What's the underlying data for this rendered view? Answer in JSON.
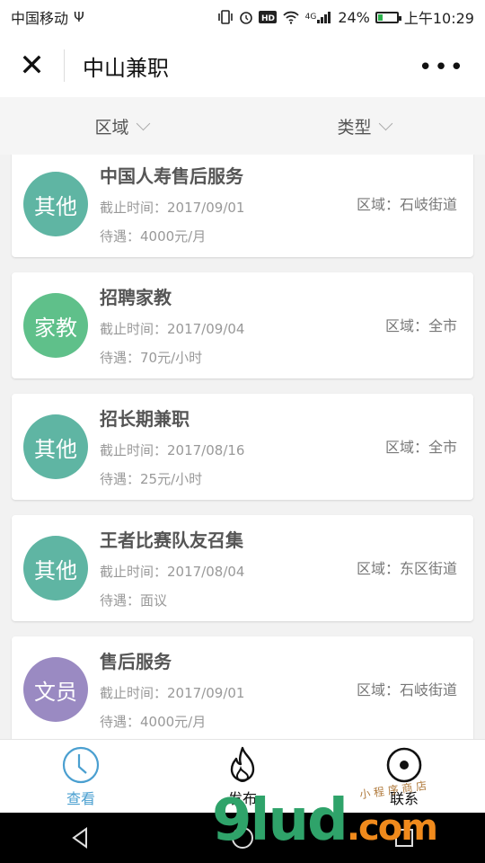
{
  "status_bar": {
    "carrier": "中国移动",
    "usb_glyph": "Ψ",
    "network": "4G",
    "battery": "24%",
    "battery_level": 0.24,
    "time": "上午10:29"
  },
  "navbar": {
    "close_glyph": "✕",
    "title": "中山兼职",
    "more_glyph": "•••"
  },
  "filters": [
    {
      "label": "区域"
    },
    {
      "label": "类型"
    }
  ],
  "jobs": [
    {
      "avatar_text": "其他",
      "avatar_color": "#5fb5a3",
      "title": "中国人寿售后服务",
      "deadline": "截止时间：2017/09/01",
      "pay": "待遇：4000元/月",
      "area": "区域：石岐街道"
    },
    {
      "avatar_text": "家教",
      "avatar_color": "#5fc08a",
      "title": "招聘家教",
      "deadline": "截止时间：2017/09/04",
      "pay": "待遇：70元/小时",
      "area": "区域：全市"
    },
    {
      "avatar_text": "其他",
      "avatar_color": "#5fb5a3",
      "title": "招长期兼职",
      "deadline": "截止时间：2017/08/16",
      "pay": "待遇：25元/小时",
      "area": "区域：全市"
    },
    {
      "avatar_text": "其他",
      "avatar_color": "#5fb5a3",
      "title": "王者比赛队友召集",
      "deadline": "截止时间：2017/08/04",
      "pay": "待遇：面议",
      "area": "区域：东区街道"
    },
    {
      "avatar_text": "文员",
      "avatar_color": "#9a8ac2",
      "title": "售后服务",
      "deadline": "截止时间：2017/09/01",
      "pay": "待遇：4000元/月",
      "area": "区域：石岐街道"
    }
  ],
  "tabbar": {
    "tabs": [
      {
        "label": "查看",
        "icon": "clock-icon",
        "active": true
      },
      {
        "label": "发布",
        "icon": "flame-icon",
        "active": false
      },
      {
        "label": "联系",
        "icon": "target-icon",
        "active": false
      }
    ],
    "active_color": "#4a9fd0"
  },
  "watermark": {
    "main": "9lud",
    "suffix": ".com",
    "small": "小 程 序 商 店"
  }
}
